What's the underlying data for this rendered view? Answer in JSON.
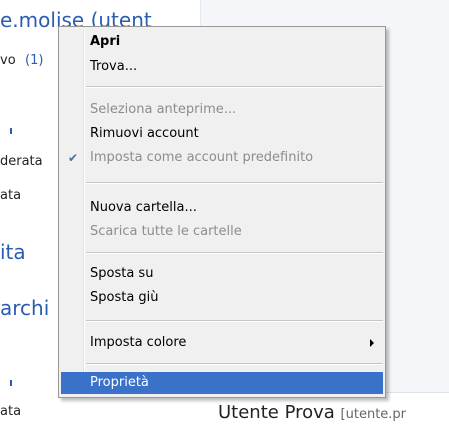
{
  "background": {
    "left_items": [
      {
        "text": "e.molise (utent",
        "style": "large"
      },
      {
        "text": "vo",
        "style": "small"
      },
      {
        "text": "(1)",
        "style": "small-blue"
      },
      {
        "text": "derata",
        "style": "small"
      },
      {
        "text": "ata",
        "style": "small"
      },
      {
        "text": "ita",
        "style": "large"
      },
      {
        "text": "archi",
        "style": "large"
      },
      {
        "text": "ata",
        "style": "small"
      }
    ],
    "preview": {
      "name": "Utente Prova",
      "email": "[utente.pr"
    }
  },
  "context_menu": {
    "items": {
      "open": {
        "label": "Apri"
      },
      "find": {
        "label": "Trova..."
      },
      "select_previews": {
        "label": "Seleziona anteprime..."
      },
      "remove_account": {
        "label": "Rimuovi account"
      },
      "set_default": {
        "label": "Imposta come account predefinito"
      },
      "new_folder": {
        "label": "Nuova cartella..."
      },
      "download_all": {
        "label": "Scarica tutte le cartelle"
      },
      "move_up": {
        "label": "Sposta su"
      },
      "move_down": {
        "label": "Sposta giù"
      },
      "set_color": {
        "label": "Imposta colore"
      },
      "properties": {
        "label": "Proprietà"
      }
    },
    "check_glyph": "✔",
    "accent_color": "#3a72c9"
  }
}
